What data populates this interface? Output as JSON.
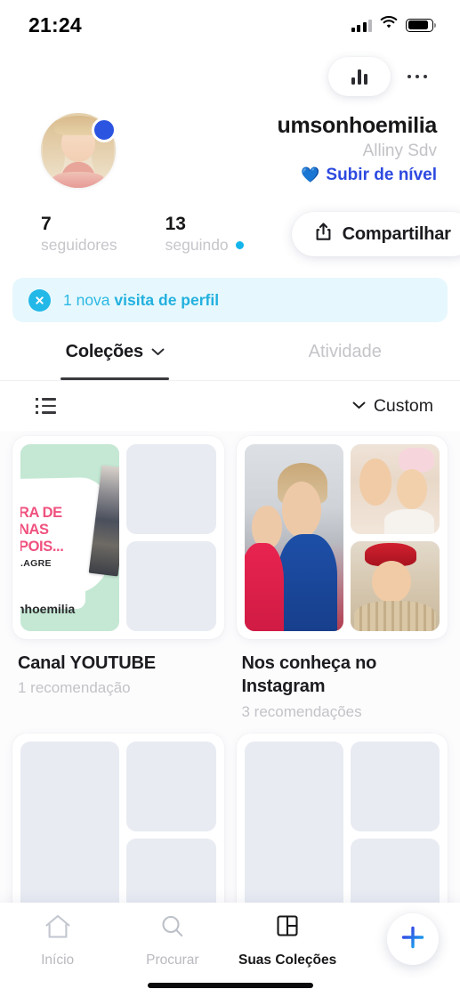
{
  "status_bar": {
    "time": "21:24",
    "signal_icon": "cellular-signal-icon",
    "wifi_icon": "wifi-icon",
    "battery_icon": "battery-icon"
  },
  "top_actions": {
    "stats_icon": "bar-chart-icon",
    "more_icon": "more-horizontal-icon"
  },
  "profile": {
    "avatar_name": "avatar",
    "badge_color": "#2b54e0",
    "username": "umsonhoemilia",
    "display_name": "Alliny Sdv",
    "level_up_label": "Subir de nível",
    "level_up_icon": "blue-heart-icon",
    "level_up_color": "#2d4ae0"
  },
  "stats": {
    "followers": {
      "count": "7",
      "label": "seguidores"
    },
    "following": {
      "count": "13",
      "label": "seguindo",
      "has_dot": true,
      "dot_color": "#13b5ea"
    },
    "share_button": {
      "label": "Compartilhar",
      "icon": "share-icon"
    }
  },
  "banner": {
    "close_icon": "close-circle-icon",
    "text_prefix": "1 nova ",
    "text_bold": "visita de perfil",
    "background_color": "#e6f8fd",
    "text_color": "#2cb8e4"
  },
  "tabs": [
    {
      "label": "Coleções",
      "active": true,
      "icon": "chevron-down-icon"
    },
    {
      "label": "Atividade",
      "active": false
    }
  ],
  "sort_row": {
    "view_icon": "list-view-icon",
    "sort_icon": "chevron-down-icon",
    "sort_label": "Custom"
  },
  "collections": [
    {
      "title": "Canal YOUTUBE",
      "count_label": "1 recomendação",
      "thumb_type": "youtube-art",
      "art_text": {
        "line1": "RA DE",
        "line2": "NAS",
        "line3": "POIS...",
        "sub": ".AGRE",
        "handle": "nhoemilia"
      },
      "art_bg_color": "#c4e8d3",
      "art_text_color": "#f0517f"
    },
    {
      "title": "Nos conheça no Instagram",
      "count_label": "3 recomendações",
      "thumb_type": "photos"
    },
    {
      "title": "",
      "count_label": "",
      "thumb_type": "empty"
    },
    {
      "title": "",
      "count_label": "",
      "thumb_type": "empty"
    }
  ],
  "bottom_nav": [
    {
      "label": "Início",
      "icon": "home-icon",
      "active": false
    },
    {
      "label": "Procurar",
      "icon": "search-icon",
      "active": false
    },
    {
      "label": "Suas Coleções",
      "icon": "collections-grid-icon",
      "active": true
    }
  ],
  "fab": {
    "icon": "plus-icon",
    "gradient_from": "#3b2fe0",
    "gradient_to": "#17b6ef"
  }
}
